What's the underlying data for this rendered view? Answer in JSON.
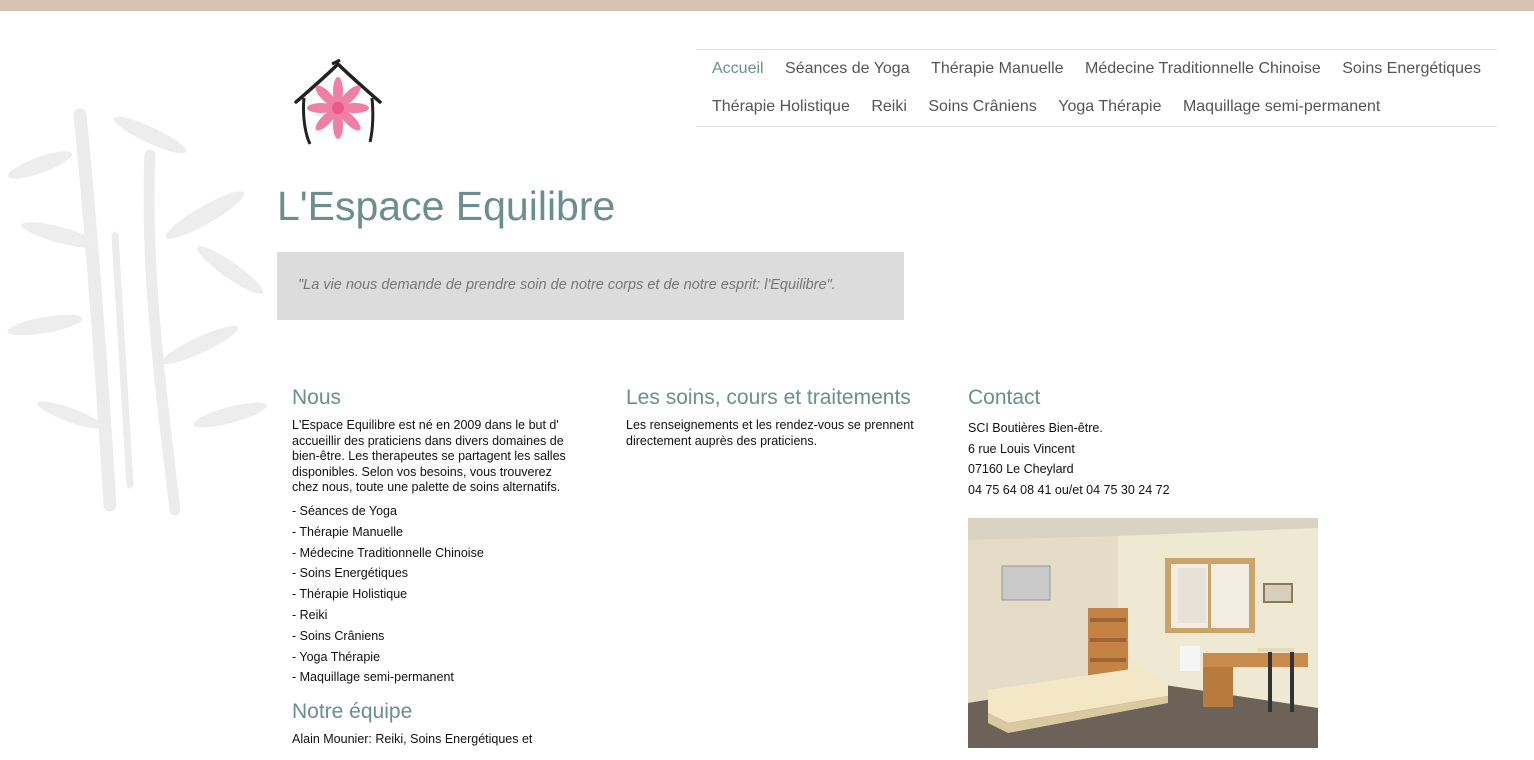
{
  "nav": {
    "row1": [
      "Accueil",
      "Séances de Yoga",
      "Thérapie Manuelle",
      "Médecine Traditionnelle Chinoise",
      "Soins Energétiques"
    ],
    "row2": [
      "Thérapie Holistique",
      "Reiki",
      "Soins Crâniens",
      "Yoga Thérapie",
      "Maquillage semi-permanent"
    ],
    "active": "Accueil"
  },
  "site": {
    "title": "L'Espace Equilibre",
    "quote": "\"La vie nous demande de prendre soin de notre corps et de notre esprit: l'Equilibre\"."
  },
  "nous": {
    "heading": "Nous",
    "text": "L'Espace Equilibre est né en 2009 dans le but d' accueillir des praticiens dans divers domaines de bien-être. Les therapeutes se partagent les salles disponibles. Selon vos besoins, vous trouverez chez nous, toute une palette de soins alternatifs.",
    "services": [
      "- Séances de Yoga",
      "- Thérapie Manuelle",
      "- Médecine Traditionnelle Chinoise",
      "- Soins Energétiques",
      "- Thérapie Holistique",
      "- Reiki",
      "- Soins Crâniens",
      "- Yoga Thérapie",
      "- Maquillage semi-permanent"
    ],
    "team_heading": "Notre équipe",
    "team_text": "Alain Mounier: Reiki, Soins Energétiques et"
  },
  "soins": {
    "heading": "Les soins, cours et traitements",
    "text": "Les renseignements et les rendez-vous se prennent directement auprès des praticiens."
  },
  "contact": {
    "heading": "Contact",
    "lines": [
      "SCI Boutières Bien-être.",
      "6 rue Louis Vincent",
      "07160 Le Cheylard",
      "04 75 64 08 41 ou/et 04 75 30 24 72"
    ]
  },
  "colors": {
    "accent": "#6b8e8e",
    "topbar": "#d6c3b5",
    "quote_bg": "#dcdcdc",
    "logo_pink": "#f07fa5"
  }
}
